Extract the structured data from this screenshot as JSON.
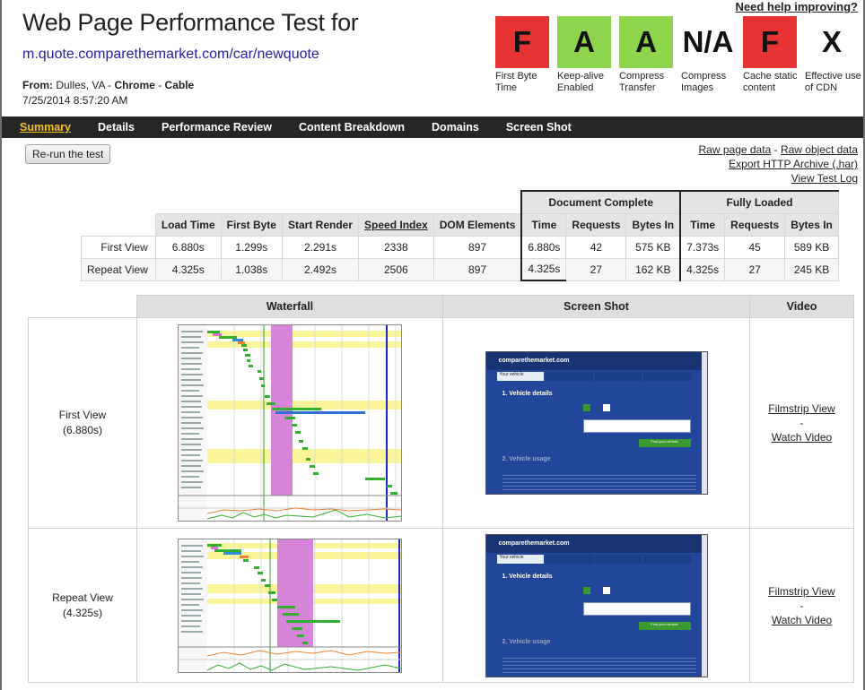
{
  "header": {
    "title": "Web Page Performance Test for",
    "url": "m.quote.comparethemarket.com/car/newquote",
    "from_label": "From:",
    "location": "Dulles, VA",
    "browser": "Chrome",
    "connection": "Cable",
    "sep": "-",
    "date": "7/25/2014 8:57:20 AM",
    "help_link": "Need help improving?"
  },
  "grades": [
    {
      "grade": "F",
      "color": "#e73333",
      "label": "First Byte Time"
    },
    {
      "grade": "A",
      "color": "#8ed44d",
      "label": "Keep-alive Enabled"
    },
    {
      "grade": "A",
      "color": "#8ed44d",
      "label": "Compress Transfer"
    },
    {
      "grade": "N/A",
      "color": "none",
      "label": "Compress Images"
    },
    {
      "grade": "F",
      "color": "#e73333",
      "label": "Cache static content"
    },
    {
      "grade": "X",
      "color": "none",
      "label": "Effective use of CDN"
    }
  ],
  "nav": {
    "items": [
      "Summary",
      "Details",
      "Performance Review",
      "Content Breakdown",
      "Domains",
      "Screen Shot"
    ],
    "active": "Summary"
  },
  "actions": {
    "rerun": "Re-run the test",
    "raw_page_data": "Raw page data",
    "link_sep": "-",
    "raw_object_data": "Raw object data",
    "export_har": "Export HTTP Archive (.har)",
    "view_log": "View Test Log"
  },
  "results": {
    "group_headers": {
      "document_complete": "Document Complete",
      "fully_loaded": "Fully Loaded"
    },
    "columns": [
      "Load Time",
      "First Byte",
      "Start Render",
      "Speed Index",
      "DOM Elements",
      "Time",
      "Requests",
      "Bytes In",
      "Time",
      "Requests",
      "Bytes In"
    ],
    "rows": [
      {
        "label": "First View",
        "cells": [
          "6.880s",
          "1.299s",
          "2.291s",
          "2338",
          "897",
          "6.880s",
          "42",
          "575 KB",
          "7.373s",
          "45",
          "589 KB"
        ]
      },
      {
        "label": "Repeat View",
        "cells": [
          "4.325s",
          "1.038s",
          "2.492s",
          "2506",
          "897",
          "4.325s",
          "27",
          "162 KB",
          "4.325s",
          "27",
          "245 KB"
        ]
      }
    ]
  },
  "views": {
    "headers": [
      "Waterfall",
      "Screen Shot",
      "Video"
    ],
    "rows": [
      {
        "name": "First View",
        "time": "(6.880s)",
        "filmstrip": "Filmstrip View",
        "sep": "-",
        "watch": "Watch Video"
      },
      {
        "name": "Repeat View",
        "time": "(4.325s)",
        "filmstrip": "Filmstrip View",
        "sep": "-",
        "watch": "Watch Video"
      }
    ]
  },
  "screenshot_thumb": {
    "logo": "comparethemarket.com",
    "tab1": "Your vehicle",
    "section1": "1. Vehicle details",
    "yes": "Yes",
    "no": "No",
    "cta": "Find your vehicle",
    "section2": "2. Vehicle usage"
  }
}
